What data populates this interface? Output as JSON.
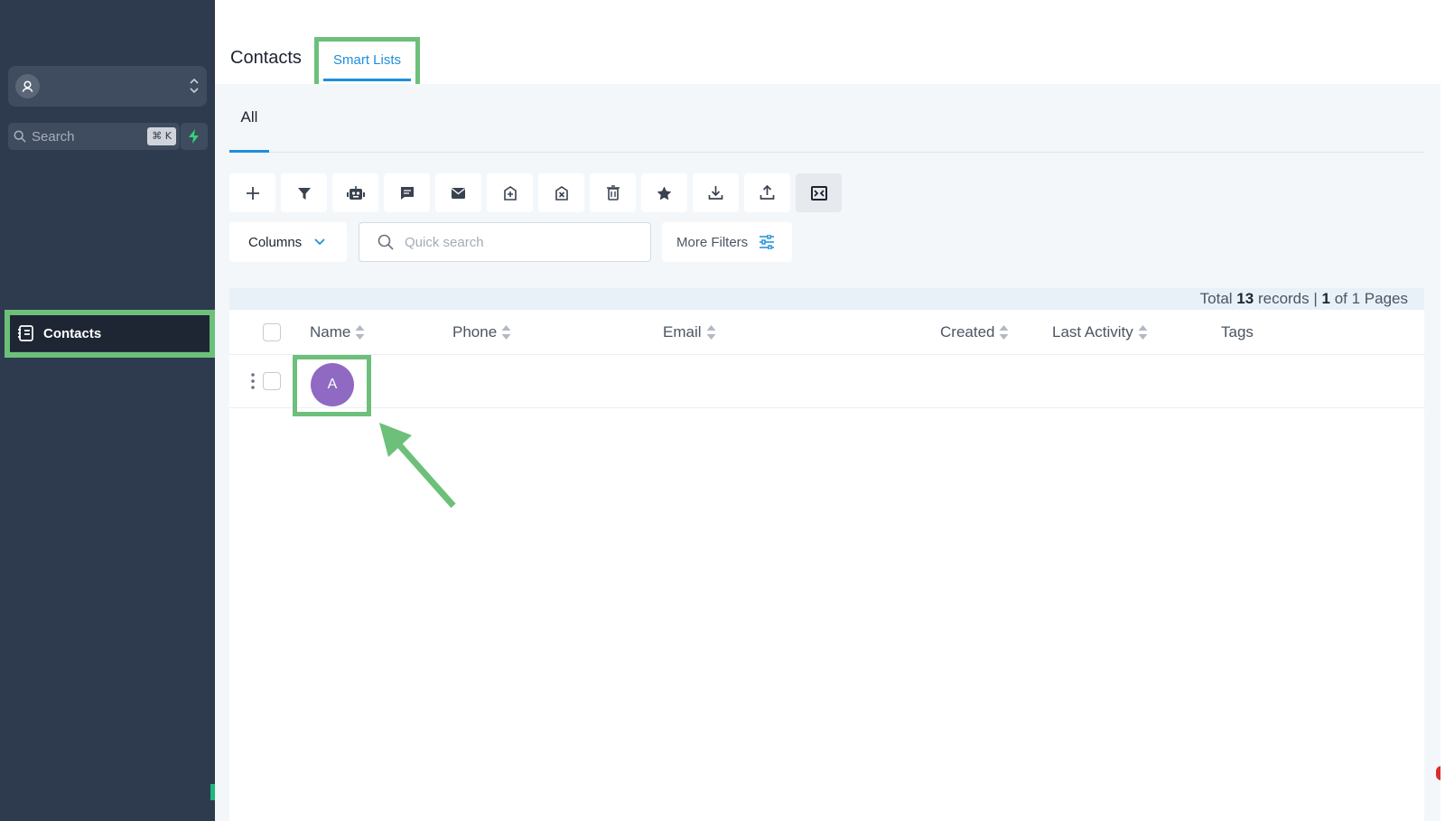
{
  "sidebar": {
    "search": {
      "label": "Search",
      "shortcut": "⌘ K"
    },
    "nav": {
      "contacts": "Contacts"
    }
  },
  "header": {
    "title": "Contacts",
    "tabs": {
      "smart_lists": "Smart Lists"
    }
  },
  "subtabs": {
    "all": "All"
  },
  "toolbar": {
    "icons": [
      "plus-icon",
      "filter-icon",
      "robot-icon",
      "message-icon",
      "mail-icon",
      "tag-add-icon",
      "tag-remove-icon",
      "trash-icon",
      "star-icon",
      "download-icon",
      "upload-icon",
      "merge-icon"
    ]
  },
  "filters": {
    "columns_label": "Columns",
    "quick_search_placeholder": "Quick search",
    "more_filters_label": "More Filters"
  },
  "records": {
    "prefix": "Total",
    "total": "13",
    "records_label": "records |",
    "page": "1",
    "of_pages": "of 1 Pages"
  },
  "table": {
    "columns": [
      "Name",
      "Phone",
      "Email",
      "Created",
      "Last Activity",
      "Tags"
    ],
    "rows": [
      {
        "avatar_initial": "A"
      }
    ]
  },
  "colors": {
    "sidebar": "#2e3a4d",
    "accent": "#1e8fdc",
    "highlight": "#6cc07a",
    "avatar": "#9069c2"
  }
}
